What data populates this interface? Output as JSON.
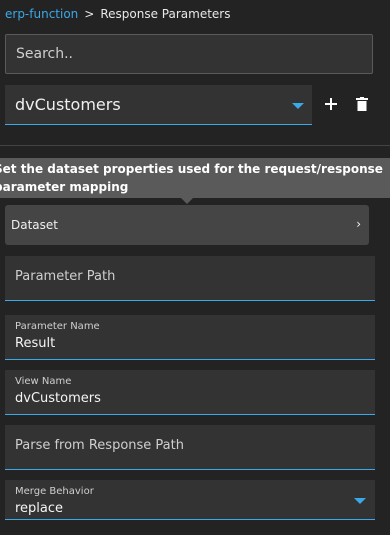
{
  "breadcrumb": {
    "parent": "erp-function",
    "separator": ">",
    "current": "Response Parameters"
  },
  "search": {
    "placeholder": "Search.."
  },
  "dataset_select": {
    "value": "dvCustomers",
    "caret_icon": "chevron-down-icon"
  },
  "actions": {
    "add_icon": "plus-icon",
    "delete_icon": "trash-icon"
  },
  "tooltip": {
    "text": "Set the dataset properties used for the request/response\nparameter mapping"
  },
  "dataset_row": {
    "label": "Dataset",
    "icon": "chevron-right-icon"
  },
  "fields": {
    "parameter_path": {
      "placeholder": "Parameter Path"
    },
    "parameter_name": {
      "label": "Parameter Name",
      "value": "Result"
    },
    "view_name": {
      "label": "View Name",
      "value": "dvCustomers"
    },
    "parse_path": {
      "placeholder": "Parse from Response Path"
    },
    "merge_behavior": {
      "label": "Merge Behavior",
      "value": "replace"
    }
  },
  "colors": {
    "accent": "#3ba8e8",
    "background": "#232323",
    "surface": "#333333",
    "tooltip": "#5a5a5a"
  }
}
